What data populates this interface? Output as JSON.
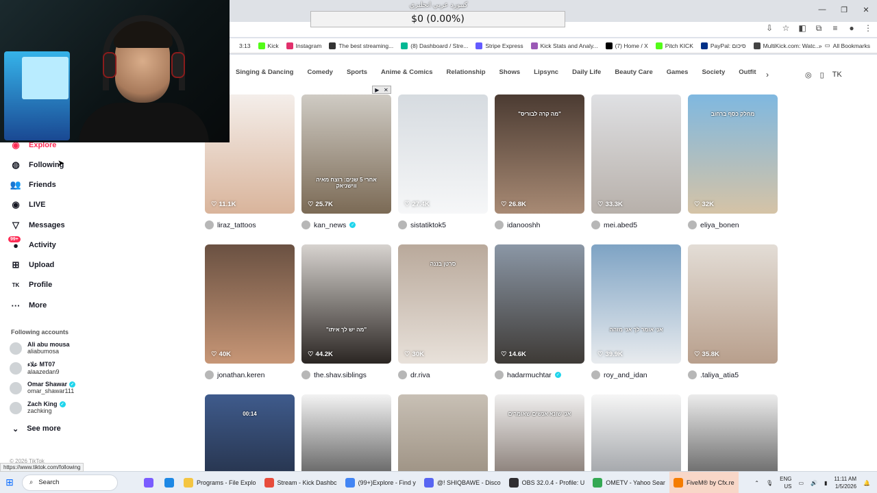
{
  "overlay": {
    "keyboard_caption": "كيبورد عربي انجليزي",
    "donation_progress": "$0 (0.00%)",
    "donation_fraction": 0.0
  },
  "window_controls": {
    "minimize": "—",
    "restore": "❐",
    "close": "✕"
  },
  "bookmarks": [
    {
      "label": "3:13",
      "color": "transparent"
    },
    {
      "label": "Kick",
      "color": "#53fc18"
    },
    {
      "label": "Instagram",
      "color": "#e1306c"
    },
    {
      "label": "The best streaming...",
      "color": "#333333"
    },
    {
      "label": "(8) Dashboard / Stre...",
      "color": "#00b894"
    },
    {
      "label": "Stripe Express",
      "color": "#635bff"
    },
    {
      "label": "Kick Stats and Analy...",
      "color": "#9b59b6"
    },
    {
      "label": "(7) Home / X",
      "color": "#000000"
    },
    {
      "label": "Pitch KICK",
      "color": "#53fc18"
    },
    {
      "label": "PayPal: סיכום",
      "color": "#003087"
    },
    {
      "label": "MultiKick.com: Watc...",
      "color": "#444444"
    }
  ],
  "bookmarks_more": "»",
  "all_bookmarks": "All Bookmarks",
  "sidebar": {
    "nav": [
      {
        "label": "Explore",
        "icon": "compass-icon",
        "glyph": "◉",
        "active": true
      },
      {
        "label": "Following",
        "icon": "following-icon",
        "glyph": "◍",
        "active": false
      },
      {
        "label": "Friends",
        "icon": "friends-icon",
        "glyph": "👥",
        "active": false
      },
      {
        "label": "LIVE",
        "icon": "live-icon",
        "glyph": "◉",
        "active": false
      },
      {
        "label": "Messages",
        "icon": "messages-icon",
        "glyph": "▽",
        "active": false
      },
      {
        "label": "Activity",
        "icon": "activity-icon",
        "glyph": "●",
        "active": false,
        "badge": "99+"
      },
      {
        "label": "Upload",
        "icon": "upload-icon",
        "glyph": "⊞",
        "active": false
      },
      {
        "label": "Profile",
        "icon": "profile-icon",
        "glyph": "TK",
        "active": false
      },
      {
        "label": "More",
        "icon": "more-icon",
        "glyph": "···",
        "active": false
      }
    ],
    "following_heading": "Following accounts",
    "accounts": [
      {
        "name": "Ali abu mousa",
        "handle": "aliabumosa",
        "verified": false
      },
      {
        "name": "علاء MT07",
        "handle": "alaazedan9",
        "verified": false
      },
      {
        "name": "Omar Shawar",
        "handle": "omar_shawar111",
        "verified": true
      },
      {
        "name": "Zach King",
        "handle": "zachking",
        "verified": true
      }
    ],
    "see_more": "See more",
    "copyright": "© 2026 TikTok",
    "status_url": "https://www.tiktok.com/following"
  },
  "categories": [
    "Singing & Dancing",
    "Comedy",
    "Sports",
    "Anime & Comics",
    "Relationship",
    "Shows",
    "Lipsync",
    "Daily Life",
    "Beauty Care",
    "Games",
    "Society",
    "Outfit"
  ],
  "videos": [
    {
      "likes": "11.1K",
      "author": "liraz_tattoos",
      "verified": false,
      "bg": "linear-gradient(180deg,#f4eeea,#d9b49b)",
      "overlay": ""
    },
    {
      "likes": "25.7K",
      "author": "kan_news",
      "verified": true,
      "bg": "linear-gradient(180deg,#cfcbc4,#7b6a55)",
      "overlay": "אחרי 5 שנים: רוצח מאיה ווישניאק"
    },
    {
      "likes": "27.4K",
      "author": "sistatiktok5",
      "verified": false,
      "bg": "linear-gradient(180deg,#d6dbe0,#f6f7f8)",
      "overlay": ""
    },
    {
      "likes": "26.8K",
      "author": "idanooshh",
      "verified": false,
      "bg": "linear-gradient(180deg,#4b3b32,#a88a74)",
      "overlay": "\"מה קרה לבוריס\""
    },
    {
      "likes": "33.3K",
      "author": "mei.abed5",
      "verified": false,
      "bg": "linear-gradient(180deg,#dfe0e3,#b7b0aa)",
      "overlay": ""
    },
    {
      "likes": "32K",
      "author": "eliya_bonen",
      "verified": false,
      "bg": "linear-gradient(180deg,#7fb8e0,#d5c3a6)",
      "overlay": "מחלק כסף ברחוב"
    },
    {
      "likes": "40K",
      "author": "jonathan.keren",
      "verified": false,
      "bg": "linear-gradient(180deg,#6a5142,#c79676)",
      "overlay": ""
    },
    {
      "likes": "44.2K",
      "author": "the.shav.siblings",
      "verified": false,
      "bg": "linear-gradient(180deg,#d7d3cf,#2b2623)",
      "overlay": "\"מה יש לך איתו\""
    },
    {
      "likes": "30K",
      "author": "dr.riva",
      "verified": false,
      "bg": "linear-gradient(180deg,#b9a99b,#e8e1da)",
      "overlay": "סרטן בננה"
    },
    {
      "likes": "14.6K",
      "author": "hadarmuchtar",
      "verified": true,
      "bg": "linear-gradient(180deg,#8b97a6,#3e3a36)",
      "overlay": ""
    },
    {
      "likes": "39.9K",
      "author": "roy_and_idan",
      "verified": false,
      "bg": "linear-gradient(180deg,#7ea3c4,#e8ebee)",
      "overlay": "אני אומר לך אני מזהה"
    },
    {
      "likes": "35.8K",
      "author": ".taliya_atia5",
      "verified": false,
      "bg": "linear-gradient(180deg,#e3ddd6,#b89f8c)",
      "overlay": ""
    },
    {
      "likes": "",
      "author": "",
      "verified": false,
      "bg": "linear-gradient(180deg,#3f5b8c,#1c2332)",
      "overlay": "00:14"
    },
    {
      "likes": "",
      "author": "",
      "verified": false,
      "bg": "linear-gradient(180deg,#f3f3f3,#222222)",
      "overlay": ""
    },
    {
      "likes": "",
      "author": "",
      "verified": false,
      "bg": "linear-gradient(180deg,#c8c0b5,#8a7d6d)",
      "overlay": ""
    },
    {
      "likes": "",
      "author": "",
      "verified": false,
      "bg": "linear-gradient(180deg,#f0efef,#5a4a40)",
      "overlay": "אני שונא אנשים שאומרים"
    },
    {
      "likes": "",
      "author": "",
      "verified": false,
      "bg": "linear-gradient(180deg,#f6f6f6,#7b7f85)",
      "overlay": ""
    },
    {
      "likes": "",
      "author": "",
      "verified": false,
      "bg": "linear-gradient(180deg,#ececec,#2d2d2d)",
      "overlay": ""
    }
  ],
  "taskbar": {
    "search_placeholder": "Search",
    "apps": [
      {
        "label": "Programs - File Explo",
        "color": "#f4c542"
      },
      {
        "label": "Stream - Kick Dashbc",
        "color": "#e74c3c"
      },
      {
        "label": "(99+)Explore - Find y",
        "color": "#4285f4"
      },
      {
        "label": "@! SHIQBAWE - Disco",
        "color": "#5865f2"
      },
      {
        "label": "OBS 32.0.4 - Profile: U",
        "color": "#302e31"
      },
      {
        "label": "OMETV - Yahoo Sear",
        "color": "#34a853"
      },
      {
        "label": "FiveM® by Cfx.re",
        "color": "#f57c00"
      }
    ],
    "lang_top": "ENG",
    "lang_bottom": "US",
    "time": "11:11 AM",
    "date": "1/5/2026"
  }
}
